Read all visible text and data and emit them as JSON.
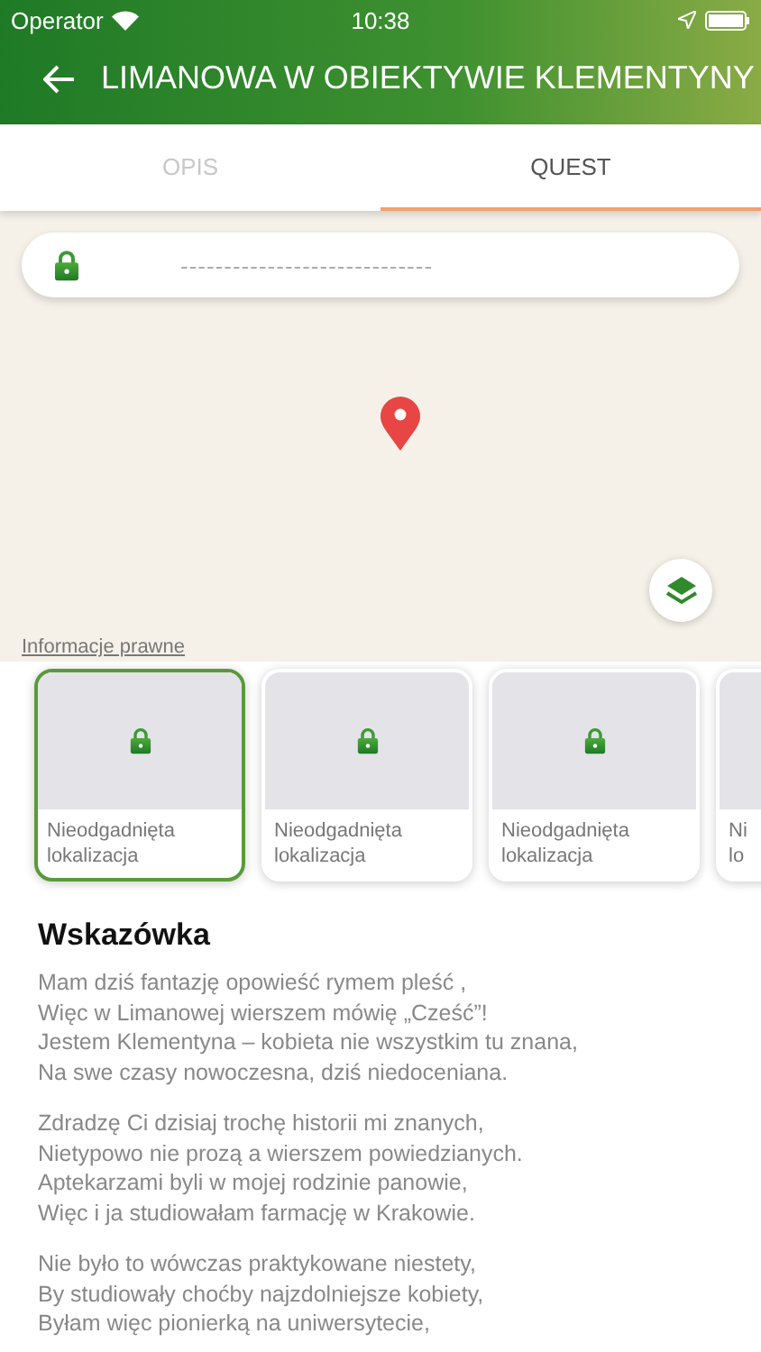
{
  "status_bar": {
    "carrier": "Operator",
    "time": "10:38"
  },
  "header": {
    "title": "LIMANOWA W OBIEKTYWIE KLEMENTYNY"
  },
  "tabs": [
    {
      "label": "OPIS",
      "selected": false
    },
    {
      "label": "QUEST",
      "selected": true
    }
  ],
  "map": {
    "answer_field": {
      "value": "-----------------------------",
      "locked": true
    },
    "legal_link": "Informacje prawne"
  },
  "locations": [
    {
      "label": "Nieodgadnięta lokalizacja",
      "locked": true,
      "selected": true
    },
    {
      "label": "Nieodgadnięta lokalizacja",
      "locked": true,
      "selected": false
    },
    {
      "label": "Nieodgadnięta lokalizacja",
      "locked": true,
      "selected": false
    },
    {
      "label": "Ni lo",
      "locked": true,
      "selected": false
    }
  ],
  "hint": {
    "title": "Wskazówka",
    "stanzas": [
      [
        "Mam dziś fantazję opowieść rymem pleść ,",
        "Więc w Limanowej wierszem mówię „Cześć”!",
        "Jestem Klementyna – kobieta nie wszystkim tu znana,",
        "Na swe czasy nowoczesna,  dziś niedoceniana."
      ],
      [
        "Zdradzę Ci dzisiaj trochę historii mi znanych,",
        "Nietypowo nie prozą a wierszem powiedzianych.",
        "Aptekarzami byli w mojej rodzinie panowie,",
        "Więc i ja studiowałam farmację w Krakowie."
      ],
      [
        "Nie było to wówczas praktykowane niestety,",
        "By studiowały choćby najzdolniejsze kobiety,",
        "Byłam więc pionierką na uniwersytecie,"
      ]
    ]
  }
}
